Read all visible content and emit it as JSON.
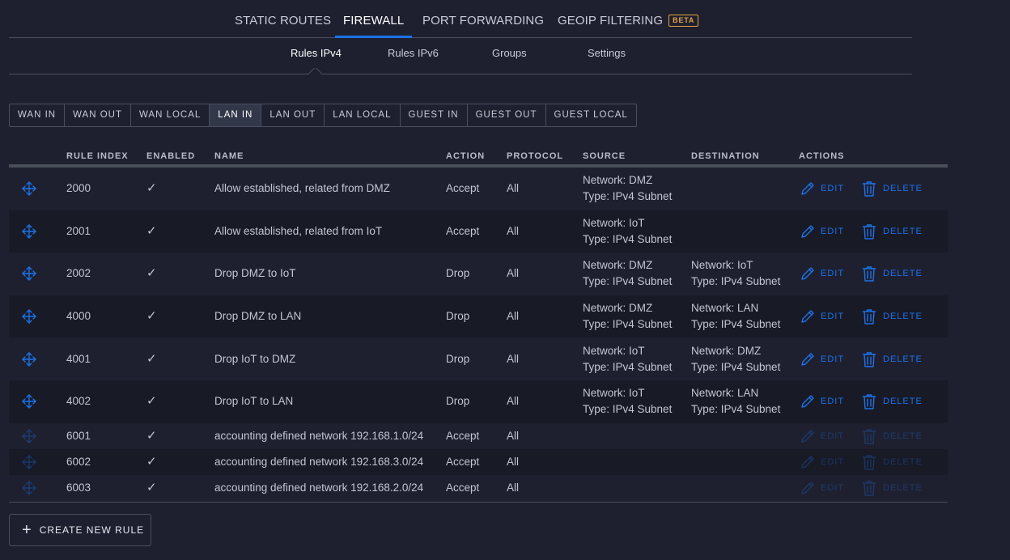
{
  "top_tabs": [
    {
      "label": "STATIC ROUTES"
    },
    {
      "label": "FIREWALL"
    },
    {
      "label": "PORT FORWARDING"
    },
    {
      "label": "GEOIP FILTERING",
      "badge": "BETA"
    }
  ],
  "sub_tabs": [
    {
      "label": "Rules IPv4"
    },
    {
      "label": "Rules IPv6"
    },
    {
      "label": "Groups"
    },
    {
      "label": "Settings"
    }
  ],
  "segments": [
    "WAN IN",
    "WAN OUT",
    "WAN LOCAL",
    "LAN IN",
    "LAN OUT",
    "LAN LOCAL",
    "GUEST IN",
    "GUEST OUT",
    "GUEST LOCAL"
  ],
  "active_segment": "LAN IN",
  "table": {
    "headers": {
      "rule_index": "RULE INDEX",
      "enabled": "ENABLED",
      "name": "NAME",
      "action": "ACTION",
      "protocol": "PROTOCOL",
      "source": "SOURCE",
      "destination": "DESTINATION",
      "actions": "ACTIONS"
    },
    "edit_label": "EDIT",
    "delete_label": "DELETE",
    "check_glyph": "✓",
    "rows": [
      {
        "index": "2000",
        "name": "Allow established, related from DMZ",
        "action": "Accept",
        "protocol": "All",
        "source": [
          "Network: DMZ",
          "Type: IPv4 Subnet"
        ],
        "destination": [],
        "faded": false
      },
      {
        "index": "2001",
        "name": "Allow established, related from IoT",
        "action": "Accept",
        "protocol": "All",
        "source": [
          "Network: IoT",
          "Type: IPv4 Subnet"
        ],
        "destination": [],
        "faded": false
      },
      {
        "index": "2002",
        "name": "Drop DMZ to IoT",
        "action": "Drop",
        "protocol": "All",
        "source": [
          "Network: DMZ",
          "Type: IPv4 Subnet"
        ],
        "destination": [
          "Network: IoT",
          "Type: IPv4 Subnet"
        ],
        "faded": false
      },
      {
        "index": "4000",
        "name": "Drop DMZ to LAN",
        "action": "Drop",
        "protocol": "All",
        "source": [
          "Network: DMZ",
          "Type: IPv4 Subnet"
        ],
        "destination": [
          "Network: LAN",
          "Type: IPv4 Subnet"
        ],
        "faded": false
      },
      {
        "index": "4001",
        "name": "Drop IoT to DMZ",
        "action": "Drop",
        "protocol": "All",
        "source": [
          "Network: IoT",
          "Type: IPv4 Subnet"
        ],
        "destination": [
          "Network: DMZ",
          "Type: IPv4 Subnet"
        ],
        "faded": false
      },
      {
        "index": "4002",
        "name": "Drop IoT to LAN",
        "action": "Drop",
        "protocol": "All",
        "source": [
          "Network: IoT",
          "Type: IPv4 Subnet"
        ],
        "destination": [
          "Network: LAN",
          "Type: IPv4 Subnet"
        ],
        "faded": false
      },
      {
        "index": "6001",
        "name": "accounting defined network 192.168.1.0/24",
        "action": "Accept",
        "protocol": "All",
        "source": [],
        "destination": [],
        "faded": true
      },
      {
        "index": "6002",
        "name": "accounting defined network 192.168.3.0/24",
        "action": "Accept",
        "protocol": "All",
        "source": [],
        "destination": [],
        "faded": true
      },
      {
        "index": "6003",
        "name": "accounting defined network 192.168.2.0/24",
        "action": "Accept",
        "protocol": "All",
        "source": [],
        "destination": [],
        "faded": true
      }
    ]
  },
  "create_button": {
    "label": "CREATE NEW RULE",
    "icon": "+"
  },
  "colors": {
    "accent": "#1d72e8",
    "badge": "#e3a43a",
    "background": "#1e2030"
  }
}
